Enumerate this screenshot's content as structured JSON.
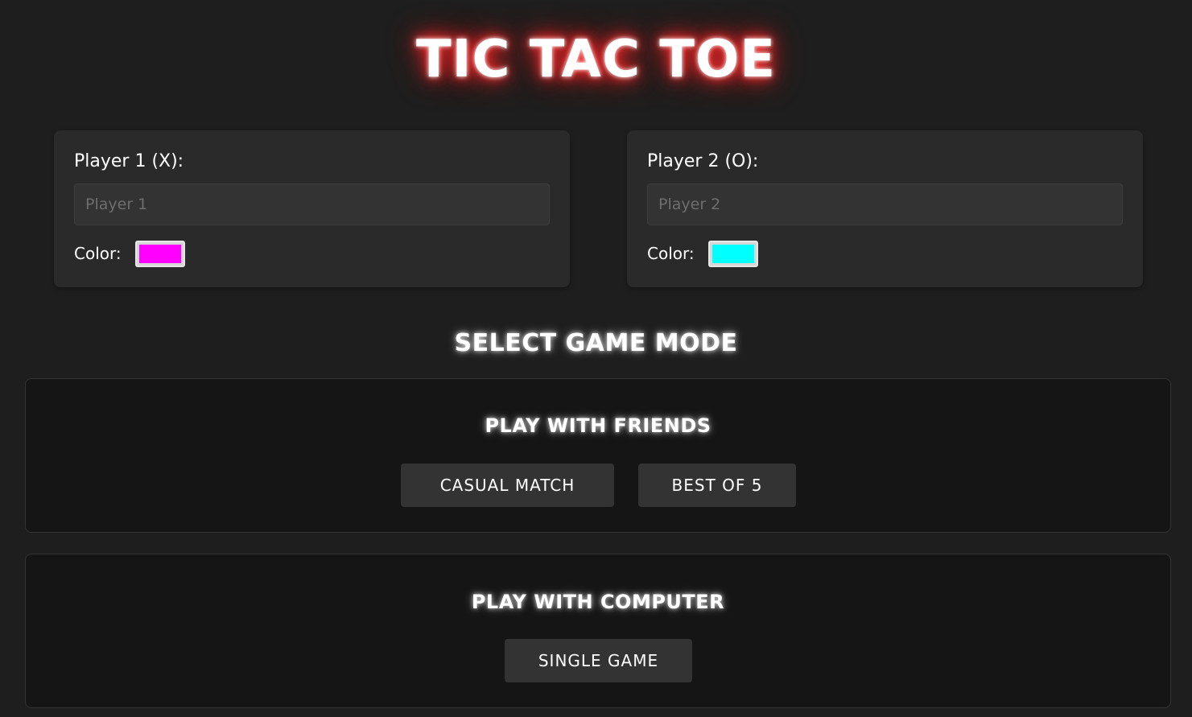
{
  "title": "TIC TAC TOE",
  "players": [
    {
      "label": "Player 1 (X):",
      "input_placeholder": "Player 1",
      "input_value": "",
      "color_label": "Color:",
      "color": "#ff00ff"
    },
    {
      "label": "Player 2 (O):",
      "input_placeholder": "Player 2",
      "input_value": "",
      "color_label": "Color:",
      "color": "#00ffff"
    }
  ],
  "mode_heading": "SELECT GAME MODE",
  "sections": {
    "friends": {
      "title": "PLAY WITH FRIENDS",
      "buttons": [
        "CASUAL MATCH",
        "BEST OF 5"
      ]
    },
    "computer": {
      "title": "PLAY WITH COMPUTER",
      "buttons": [
        "SINGLE GAME"
      ]
    }
  },
  "colors": {
    "background": "#1e1e1e",
    "card": "#2a2a2a",
    "section": "#151515",
    "button": "#333333",
    "title_glow": "#ff2a2a"
  }
}
